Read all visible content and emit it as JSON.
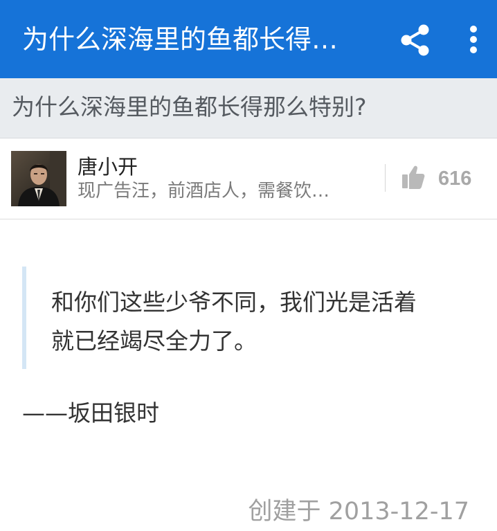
{
  "appbar": {
    "title": "为什么深海里的鱼都长得…",
    "share_icon": "share-icon",
    "more_icon": "more-vertical-icon",
    "background_color": "#1673d8"
  },
  "question": {
    "title": "为什么深海里的鱼都长得那么特别?"
  },
  "author": {
    "name": "唐小开",
    "bio": "现广告汪，前酒店人，需餐饮…",
    "avatar_icon": "avatar"
  },
  "vote": {
    "icon": "thumbs-up-icon",
    "count": "616"
  },
  "answer": {
    "quote": "和你们这些少爷不同，我们光是活着就已经竭尽全力了。",
    "attribution": "——坂田银时",
    "created": "创建于 2013-12-17"
  }
}
